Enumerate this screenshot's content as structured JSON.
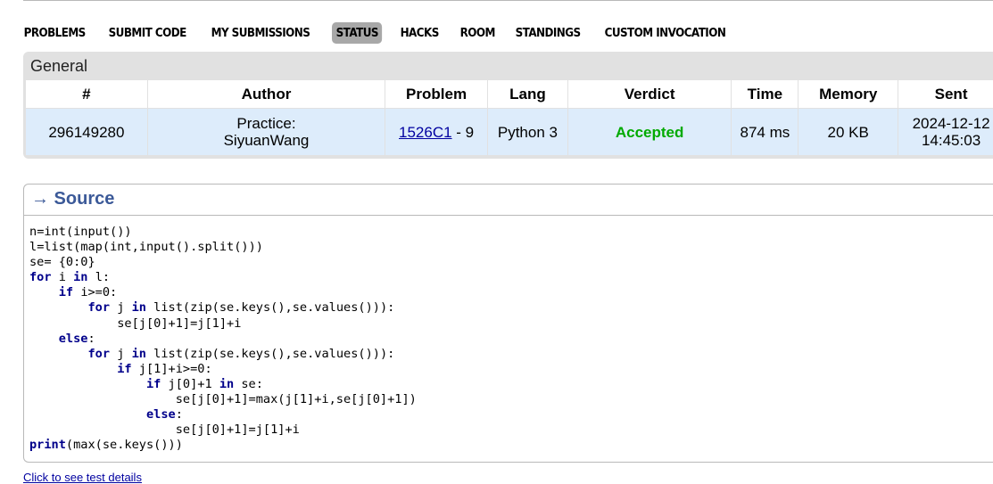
{
  "menu": {
    "items": [
      "PROBLEMS",
      "SUBMIT CODE",
      "MY SUBMISSIONS",
      "STATUS",
      "HACKS",
      "ROOM",
      "STANDINGS",
      "CUSTOM INVOCATION"
    ],
    "selected": "STATUS"
  },
  "general": {
    "title": "General",
    "headers": [
      "#",
      "Author",
      "Problem",
      "Lang",
      "Verdict",
      "Time",
      "Memory",
      "Sent"
    ],
    "row": {
      "id": "296149280",
      "author_prefix": "Practice:",
      "author_name": "SiyuanWang",
      "problem_id": "1526C1",
      "problem_suffix": " - 9",
      "lang": "Python 3",
      "verdict": "Accepted",
      "time": "874 ms",
      "memory": "20 KB",
      "sent_date": "2024-12-12",
      "sent_time": "14:45:03"
    }
  },
  "source": {
    "title": "→ Source",
    "code": [
      "n=int(input())",
      "l=list(map(int,input().split()))",
      "se= {0:0}",
      "for i in l:",
      "    if i>=0:",
      "        for j in list(zip(se.keys(),se.values())):",
      "            se[j[0]+1]=j[1]+i",
      "    else:",
      "        for j in list(zip(se.keys(),se.values())):",
      "            if j[1]+i>=0:",
      "                if j[0]+1 in se:",
      "                    se[j[0]+1]=max(j[1]+i,se[j[0]+1])",
      "                else:",
      "                    se[j[0]+1]=j[1]+i",
      "print(max(se.keys()))"
    ],
    "keywords": [
      "for",
      "in",
      "if",
      "else",
      "print"
    ]
  },
  "footer": {
    "link_text": "Click to see test details"
  },
  "colors": {
    "accepted": "#00aa00",
    "link": "#0000a0",
    "source_title": "#3b5998",
    "row_bg": "#ddecfb",
    "menu_selected_bg": "#a8a8a8"
  }
}
